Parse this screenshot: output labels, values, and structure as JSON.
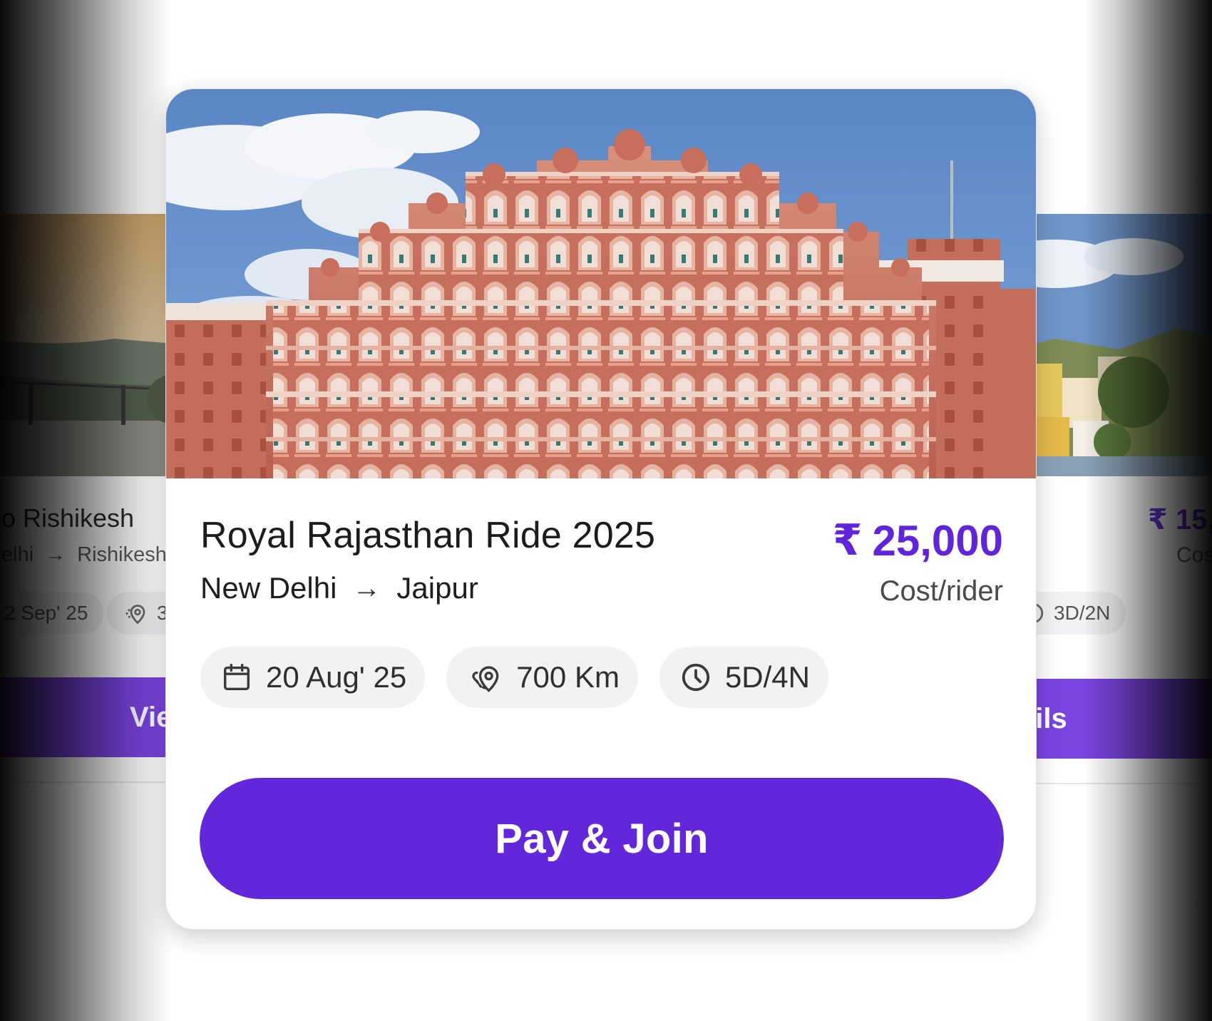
{
  "colors": {
    "accent": "#6327DB",
    "price": "#6124DD",
    "chip_bg": "#F2F2F4",
    "side_button": "#7A44E0"
  },
  "left_card": {
    "title": "o Rishikesh",
    "route_from": "elhi",
    "route_arrow": "→",
    "route_to": "Rishikesh",
    "date": "2 Sep' 25",
    "distance": "3",
    "button_label": "Vie"
  },
  "right_card": {
    "price": "₹ 15,",
    "cost_label": "Cos",
    "duration": "3D/2N",
    "button_label": "ails"
  },
  "main_card": {
    "title": "Royal Rajasthan Ride 2025",
    "route_from": "New Delhi",
    "route_arrow": "→",
    "route_to": "Jaipur",
    "currency_symbol": "₹",
    "price": "25,000",
    "cost_label": "Cost/rider",
    "chips": [
      {
        "icon": "calendar-icon",
        "label": "20 Aug' 25"
      },
      {
        "icon": "route-pin-icon",
        "label": "700 Km"
      },
      {
        "icon": "clock-icon",
        "label": "5D/4N"
      }
    ],
    "pay_button": "Pay & Join"
  }
}
